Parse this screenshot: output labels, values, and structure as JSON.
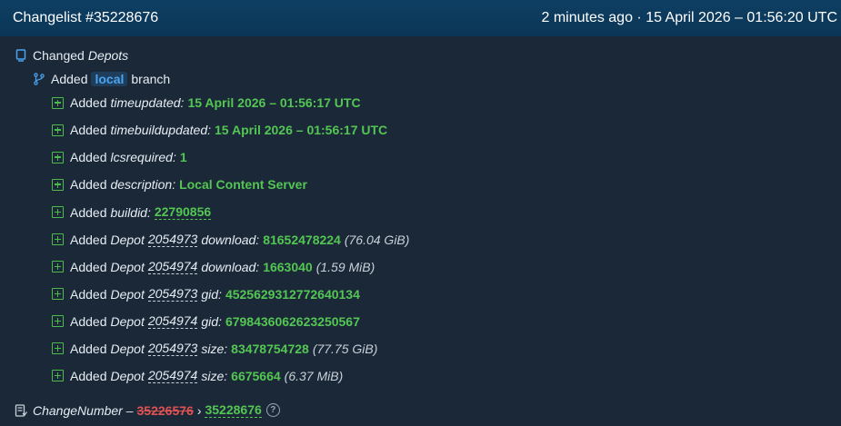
{
  "header": {
    "title": "Changelist #35228676",
    "time": "2 minutes ago · 15 April 2026 – 01:56:20 UTC"
  },
  "changed": {
    "label": "Changed",
    "depots": "Depots"
  },
  "branch": {
    "added": "Added",
    "name": "local",
    "suffix": "branch"
  },
  "entries": [
    {
      "added": "Added",
      "key": "timeupdated:",
      "value": "15 April 2026 – 01:56:17 UTC"
    },
    {
      "added": "Added",
      "key": "timebuildupdated:",
      "value": "15 April 2026 – 01:56:17 UTC"
    },
    {
      "added": "Added",
      "key": "lcsrequired:",
      "value": "1"
    },
    {
      "added": "Added",
      "key": "description:",
      "value": "Local Content Server"
    },
    {
      "added": "Added",
      "key": "buildid:",
      "value": "22790856"
    },
    {
      "added": "Added",
      "depot": "Depot",
      "id": "2054973",
      "key": "download:",
      "value": "81652478224",
      "note": "(76.04 GiB)"
    },
    {
      "added": "Added",
      "depot": "Depot",
      "id": "2054974",
      "key": "download:",
      "value": "1663040",
      "note": "(1.59 MiB)"
    },
    {
      "added": "Added",
      "depot": "Depot",
      "id": "2054973",
      "key": "gid:",
      "value": "4525629312772640134"
    },
    {
      "added": "Added",
      "depot": "Depot",
      "id": "2054974",
      "key": "gid:",
      "value": "6798436062623250567"
    },
    {
      "added": "Added",
      "depot": "Depot",
      "id": "2054973",
      "key": "size:",
      "value": "83478754728",
      "note": "(77.75 GiB)"
    },
    {
      "added": "Added",
      "depot": "Depot",
      "id": "2054974",
      "key": "size:",
      "value": "6675664",
      "note": "(6.37 MiB)"
    }
  ],
  "change_number": {
    "label": "ChangeNumber –",
    "old": "35226576",
    "arrow": "›",
    "new": "35228676",
    "help": "?"
  },
  "colors": {
    "added": "#53c653",
    "removed": "#e05252",
    "accent": "#4aa3f0"
  },
  "icons": [
    "depot-icon",
    "branch-icon",
    "plus-square-icon",
    "changenumber-icon",
    "help-icon"
  ]
}
